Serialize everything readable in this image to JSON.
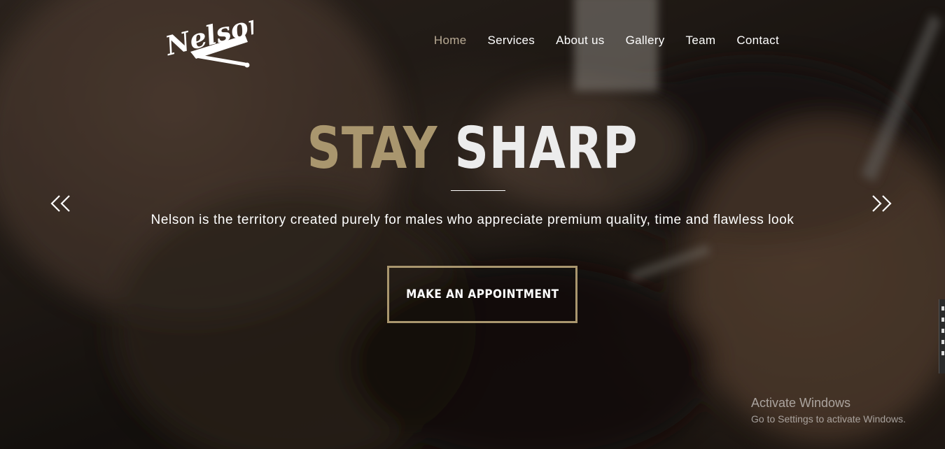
{
  "brand": {
    "logo_text": "Nelson",
    "logo_icon": "straight-razor-icon"
  },
  "nav": {
    "items": [
      {
        "label": "Home",
        "active": true
      },
      {
        "label": "Services",
        "active": false
      },
      {
        "label": "About us",
        "active": false
      },
      {
        "label": "Gallery",
        "active": false
      },
      {
        "label": "Team",
        "active": false
      },
      {
        "label": "Contact",
        "active": false
      }
    ],
    "active_color": "#b8aa94"
  },
  "hero": {
    "headline_word1": "STAY",
    "headline_word2": "SHARP",
    "subtitle": "Nelson is the territory created purely for males who appreciate premium quality, time and flawless look",
    "cta_label": "MAKE AN APPOINTMENT",
    "prev_icon": "double-chevron-left-icon",
    "next_icon": "double-chevron-right-icon"
  },
  "colors": {
    "accent": "#a9966e",
    "headline_light": "#ececec"
  },
  "watermark": {
    "title": "Activate Windows",
    "subtitle": "Go to Settings to activate Windows."
  }
}
